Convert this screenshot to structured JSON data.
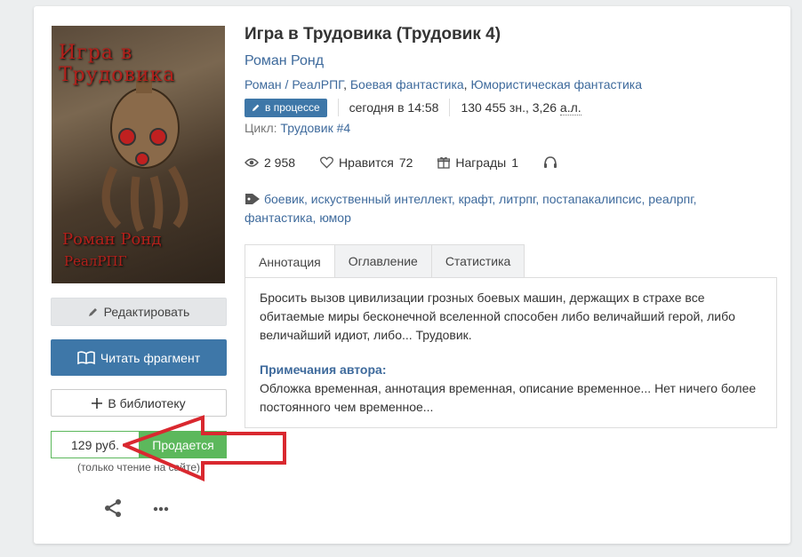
{
  "book": {
    "title": "Игра в Трудовика (Трудовик 4)",
    "author": "Роман Ронд",
    "genres": [
      "Роман / РеалРПГ",
      "Боевая фантастика",
      "Юмористическая фантастика"
    ],
    "status_badge": "в процессе",
    "updated": "сегодня в 14:58",
    "size": "130 455 зн., 3,26",
    "size_unit": "а.л.",
    "cycle_label": "Цикл:",
    "cycle_value": "Трудовик #4",
    "views": "2 958",
    "likes_label": "Нравится",
    "likes_count": "72",
    "awards_label": "Награды",
    "awards_count": "1",
    "tags": [
      "боевик",
      "искуственный интеллект",
      "крафт",
      "литрпг",
      "постапакалипсис",
      "реалрпг",
      "фантастика",
      "юмор"
    ]
  },
  "cover": {
    "title_text": "Игра в Трудовика",
    "author_text": "Роман Ронд",
    "genre_text": "РеалРПГ"
  },
  "actions": {
    "edit": "Редактировать",
    "read": "Читать фрагмент",
    "library": "В библиотеку",
    "price": "129 руб.",
    "sale": "Продается",
    "price_note": "(только чтение на сайте)"
  },
  "tabs": [
    {
      "label": "Аннотация",
      "active": true
    },
    {
      "label": "Оглавление",
      "active": false
    },
    {
      "label": "Статистика",
      "active": false
    }
  ],
  "annotation": {
    "text": "Бросить вызов цивилизации грозных боевых машин, держащих в страхе все обитаемые миры бесконечной вселенной способен либо величайший герой, либо величайший идиот, либо... Трудовик.",
    "notes_heading": "Примечания автора:",
    "notes_text": "Обложка временная, аннотация временная, описание временное... Нет ничего более постоянного чем временное..."
  },
  "icons": {
    "status": "pencil-icon",
    "views": "eye-icon",
    "likes": "heart-icon",
    "awards": "gift-icon",
    "audio": "headphones-icon",
    "tags": "tag-icon",
    "share": "share-icon",
    "more": "ellipsis-icon"
  },
  "colors": {
    "link": "#3e6a9c",
    "primary": "#3e77a8",
    "sale": "#5cb85c",
    "annotation_arrow": "#d9282f"
  }
}
